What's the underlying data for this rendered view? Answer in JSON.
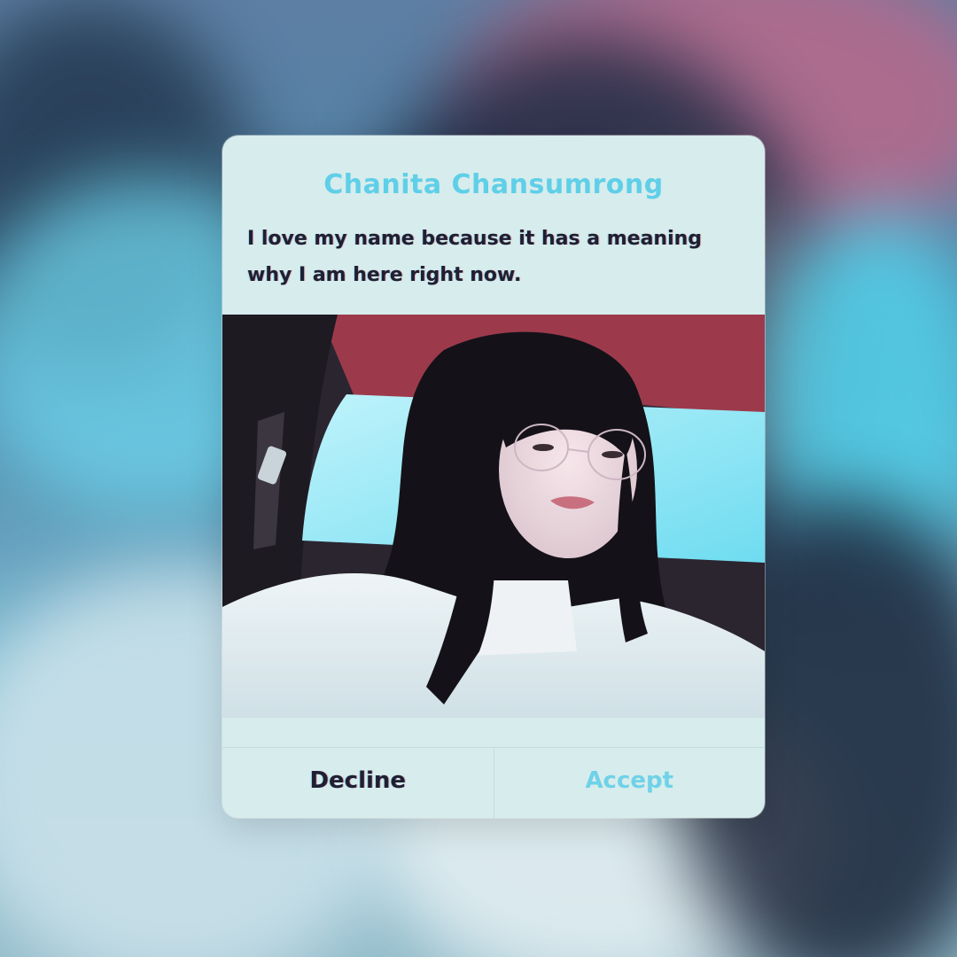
{
  "dialog": {
    "title": "Chanita Chansumrong",
    "message": "I love my name because it has a meaning why I am here right now.",
    "decline_label": "Decline",
    "accept_label": "Accept"
  },
  "colors": {
    "title": "#5fcfe8",
    "accept": "#6fd2e8",
    "text": "#1f1f33",
    "card_background": "#d7ecec"
  }
}
